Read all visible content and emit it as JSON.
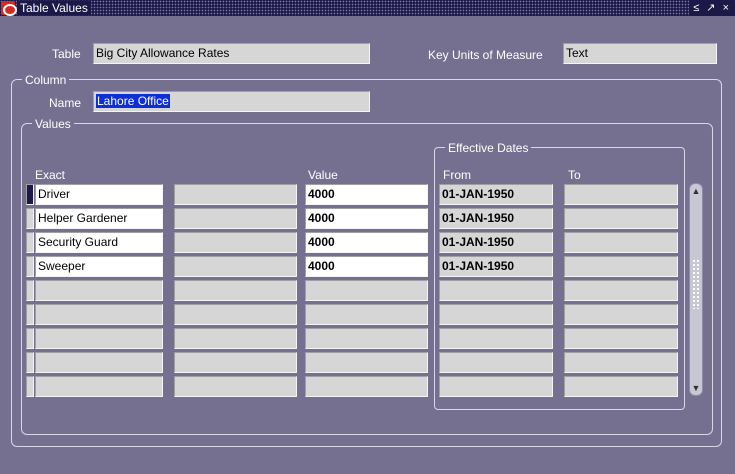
{
  "window": {
    "title": "Table Values",
    "controls": "≤ ↗ ×"
  },
  "header": {
    "table_label": "Table",
    "table_value": "Big City Allowance Rates",
    "key_units_label": "Key Units of Measure",
    "key_units_value": "Text"
  },
  "column": {
    "group_label": "Column",
    "name_label": "Name",
    "name_value": "Lahore Office"
  },
  "values": {
    "group_label": "Values",
    "effective_dates_label": "Effective Dates",
    "headers": {
      "exact": "Exact",
      "value": "Value",
      "from": "From",
      "to": "To"
    },
    "rows": [
      {
        "exact": "Driver",
        "value": "4000",
        "from": "01-JAN-1950",
        "to": ""
      },
      {
        "exact": "Helper Gardener",
        "value": "4000",
        "from": "01-JAN-1950",
        "to": ""
      },
      {
        "exact": "Security Guard",
        "value": "4000",
        "from": "01-JAN-1950",
        "to": ""
      },
      {
        "exact": "Sweeper",
        "value": "4000",
        "from": "01-JAN-1950",
        "to": ""
      },
      {
        "exact": "",
        "value": "",
        "from": "",
        "to": ""
      },
      {
        "exact": "",
        "value": "",
        "from": "",
        "to": ""
      },
      {
        "exact": "",
        "value": "",
        "from": "",
        "to": ""
      },
      {
        "exact": "",
        "value": "",
        "from": "",
        "to": ""
      },
      {
        "exact": "",
        "value": "",
        "from": "",
        "to": ""
      }
    ]
  }
}
